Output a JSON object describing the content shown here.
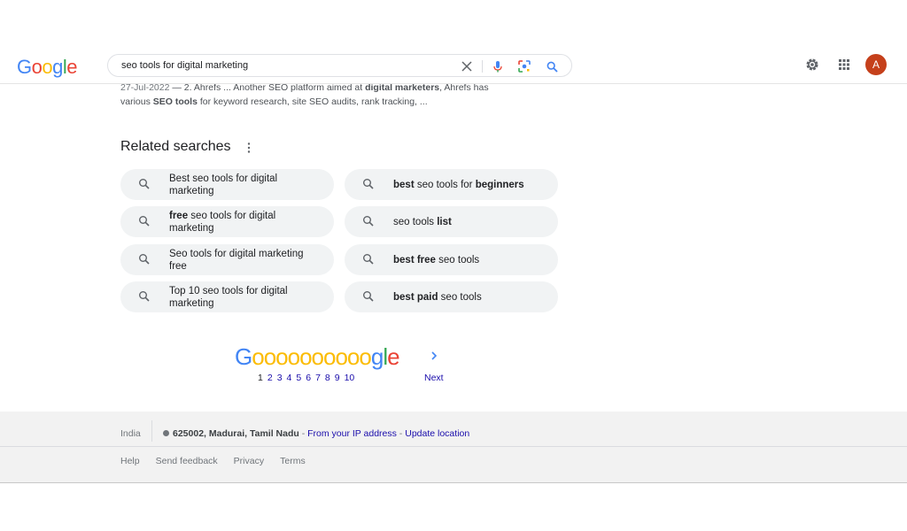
{
  "header": {
    "logo_letters": [
      "G",
      "o",
      "o",
      "g",
      "l",
      "e"
    ],
    "search_value": "seo tools for digital marketing"
  },
  "snippet": {
    "date": "27-Jul-2022",
    "sep": " — ",
    "text1": "2. Ahrefs ... Another SEO platform aimed at ",
    "bold1": "digital marketers",
    "text2": ", Ahrefs has various ",
    "bold2": "SEO tools",
    "text3": " for keyword research, site SEO audits, rank tracking, ..."
  },
  "related": {
    "title": "Related searches",
    "left": [
      {
        "plain_before": "Best seo tools for digital marketing",
        "bold": "",
        "plain_after": ""
      },
      {
        "plain_before": "",
        "bold": "free",
        "plain_after": " seo tools for digital marketing"
      },
      {
        "plain_before": "Seo tools for digital marketing free",
        "bold": "",
        "plain_after": ""
      },
      {
        "plain_before": "Top 10 seo tools for digital marketing",
        "bold": "",
        "plain_after": ""
      }
    ],
    "right": [
      {
        "p1": "",
        "b1": "best",
        "p2": " seo tools for ",
        "b2": "beginners",
        "p3": ""
      },
      {
        "p1": "seo tools ",
        "b1": "list",
        "p2": "",
        "b2": "",
        "p3": ""
      },
      {
        "p1": "",
        "b1": "best free",
        "p2": " seo tools",
        "b2": "",
        "p3": ""
      },
      {
        "p1": "",
        "b1": "best paid",
        "p2": " seo tools",
        "b2": "",
        "p3": ""
      }
    ]
  },
  "pagination": {
    "logo_G": "G",
    "logo_o": "oooooooooo",
    "logo_gle": [
      "g",
      "l",
      "e"
    ],
    "pages": [
      "1",
      "2",
      "3",
      "4",
      "5",
      "6",
      "7",
      "8",
      "9",
      "10"
    ],
    "current": "1",
    "next": "Next"
  },
  "footer": {
    "country": "India",
    "location_bold": "625002, Madurai, Tamil Nadu",
    "dash1": " - ",
    "ip_link": "From your IP address",
    "dash2": " - ",
    "update_link": "Update location",
    "links": [
      "Help",
      "Send feedback",
      "Privacy",
      "Terms"
    ]
  },
  "avatar": {
    "letter": "A"
  },
  "colors": {
    "blue": "#4285f4",
    "red": "#ea4335",
    "yellow": "#fbbc05",
    "green": "#34a853"
  }
}
